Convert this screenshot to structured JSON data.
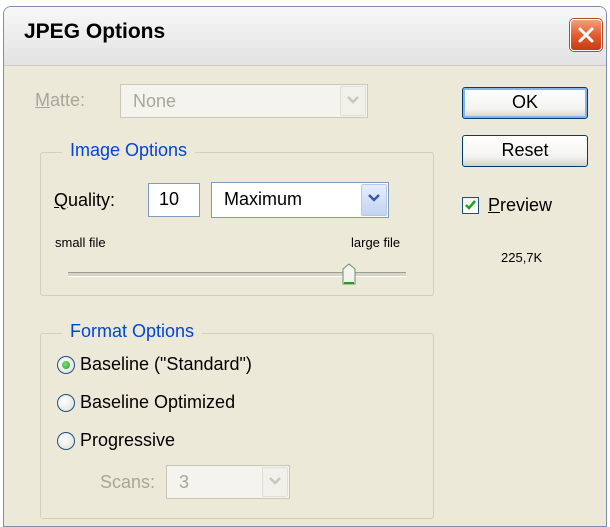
{
  "window": {
    "title": "JPEG Options"
  },
  "matte": {
    "label_u": "M",
    "label_rest": "atte:",
    "value": "None"
  },
  "image_options": {
    "legend": "Image Options",
    "quality_label_u": "Q",
    "quality_label_rest": "uality:",
    "quality_value": "10",
    "quality_preset": "Maximum",
    "slider_min_label": "small file",
    "slider_max_label": "large file",
    "slider_level": 0.83
  },
  "format_options": {
    "legend": "Format Options",
    "options": [
      {
        "label": "Baseline (\"Standard\")",
        "selected": true
      },
      {
        "label": "Baseline Optimized",
        "selected": false
      },
      {
        "label": "Progressive",
        "selected": false
      }
    ],
    "scans_label": "Scans:",
    "scans_value": "3"
  },
  "buttons": {
    "ok": "OK",
    "reset": "Reset"
  },
  "preview": {
    "label_u": "P",
    "label_rest": "review",
    "checked": true,
    "file_size": "225,7K"
  },
  "colors": {
    "accent": "#0046d5",
    "disabled_text": "#a7a69a",
    "dialog_bg": "#ece9d8"
  },
  "icons": {
    "close": "close-icon",
    "dropdown": "chevron-down-icon",
    "check": "checkmark-icon"
  }
}
